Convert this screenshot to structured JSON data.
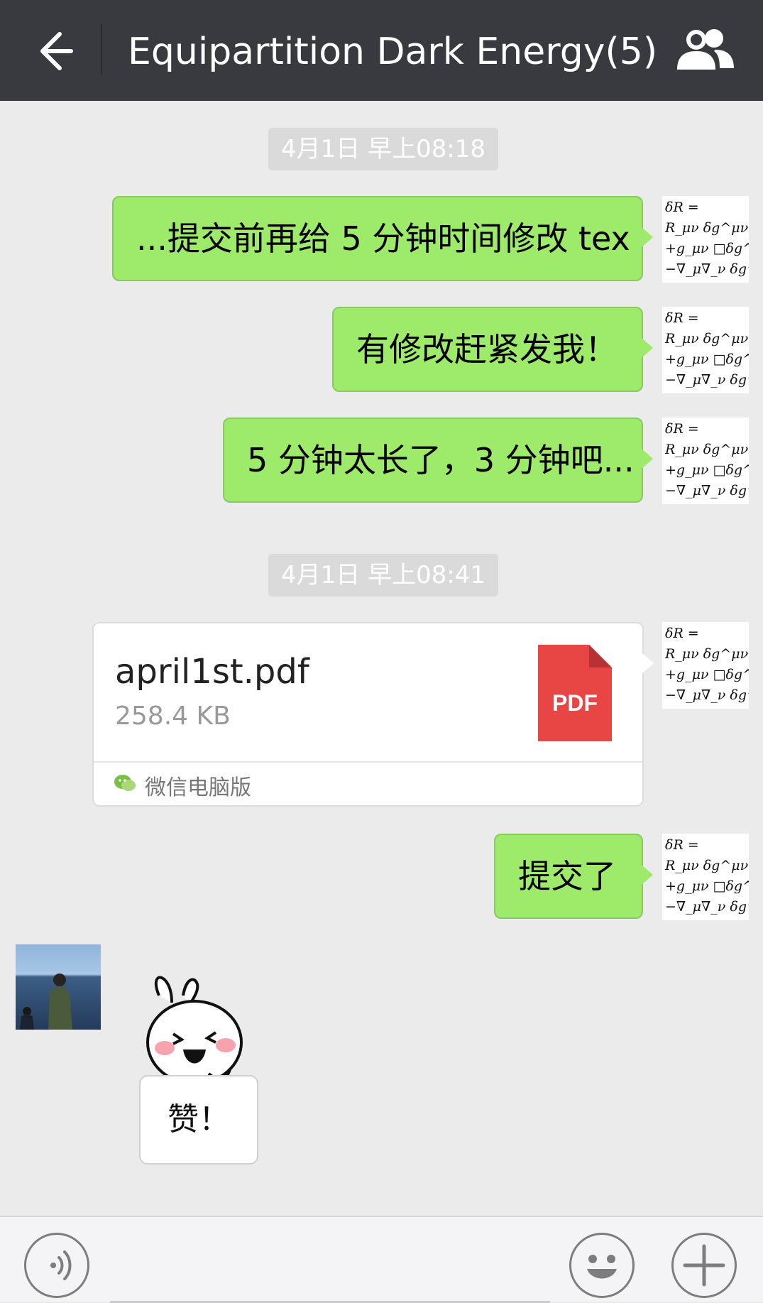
{
  "header": {
    "title": "Equipartition Dark Energy(5)"
  },
  "formula_avatar": {
    "lines": [
      "δR =",
      "R_μν δg^μν",
      "+g_μν □δg^μν",
      "−∇_μ∇_ν δg^μν"
    ]
  },
  "messages": [
    {
      "type": "timestamp",
      "text": "4月1日 早上08:18"
    },
    {
      "type": "text",
      "text": "...提交前再给 5 分钟时间修改 tex"
    },
    {
      "type": "text",
      "text": "有修改赶紧发我！"
    },
    {
      "type": "text",
      "text": "5 分钟太长了，3 分钟吧..."
    },
    {
      "type": "timestamp",
      "text": "4月1日 早上08:41"
    },
    {
      "type": "file",
      "file_name": "april1st.pdf",
      "file_size": "258.4 KB",
      "icon_label": "PDF",
      "source": "微信电脑版"
    },
    {
      "type": "text",
      "text": "提交了"
    },
    {
      "type": "sticker",
      "text": "赞！"
    }
  ],
  "colors": {
    "header_bg": "#393a3f",
    "bubble_green": "#9eea6a",
    "pdf_red": "#e84545",
    "chat_bg": "#ebebeb"
  },
  "icons": {
    "back": "arrow-left-icon",
    "group": "people-icon",
    "voice": "voice-icon",
    "emoji": "smiley-icon",
    "more": "plus-icon"
  }
}
